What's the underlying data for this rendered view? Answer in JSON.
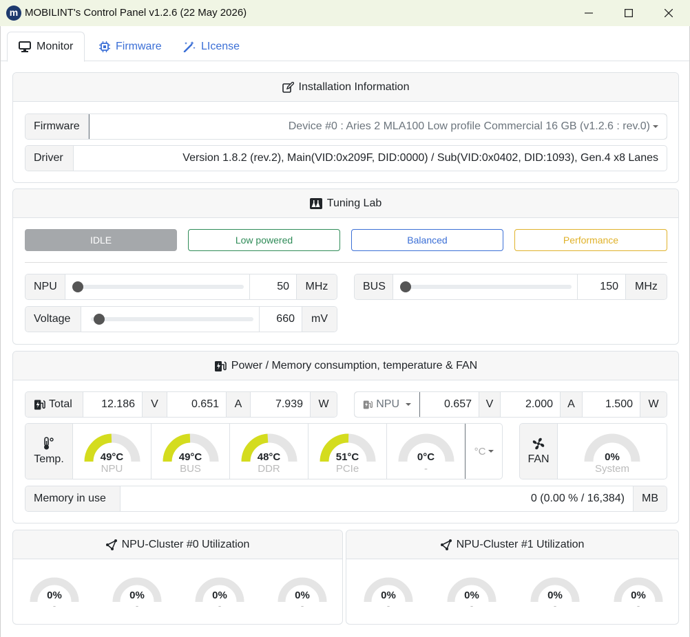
{
  "window": {
    "title": "MOBILINT's Control Panel v1.2.6 (22 May 2026)",
    "logo": "m"
  },
  "tabs": [
    {
      "label": "Monitor",
      "icon": "monitor-icon"
    },
    {
      "label": "Firmware",
      "icon": "chip-icon"
    },
    {
      "label": "LIcense",
      "icon": "wand-icon"
    }
  ],
  "install": {
    "title": "Installation Information",
    "firmware_label": "Firmware",
    "firmware_value": "Device #0 : Aries 2 MLA100 Low profile Commercial 16 GB (v1.2.6 : rev.0)",
    "driver_label": "Driver",
    "driver_value": "Version 1.8.2 (rev.2), Main(VID:0x209F, DID:0000) / Sub(VID:0x0402, DID:1093), Gen.4 x8 Lanes"
  },
  "tuning": {
    "title": "Tuning Lab",
    "modes": [
      {
        "label": "IDLE",
        "color": "#a5a8ab"
      },
      {
        "label": "Low powered",
        "color": "#2e8b57"
      },
      {
        "label": "Balanced",
        "color": "#3b6fd6"
      },
      {
        "label": "Performance",
        "color": "#e0b22a"
      }
    ],
    "npu": {
      "label": "NPU",
      "value": "50",
      "unit": "MHz",
      "level": 0.0
    },
    "bus": {
      "label": "BUS",
      "value": "150",
      "unit": "MHz",
      "level": 0.0
    },
    "voltage": {
      "label": "Voltage",
      "value": "660",
      "unit": "mV",
      "level": 0.05
    }
  },
  "power": {
    "title": "Power / Memory consumption, temperature & FAN",
    "total": {
      "label": "Total",
      "v": "12.186",
      "v_unit": "V",
      "a": "0.651",
      "a_unit": "A",
      "w": "7.939",
      "w_unit": "W"
    },
    "npu": {
      "label": "NPU",
      "v": "0.657",
      "v_unit": "V",
      "a": "2.000",
      "a_unit": "A",
      "w": "1.500",
      "w_unit": "W"
    },
    "temp_label": "Temp.",
    "temps": [
      {
        "value": "49°C",
        "label": "NPU",
        "level": 0.49,
        "color": "#d4dc1e"
      },
      {
        "value": "49°C",
        "label": "BUS",
        "level": 0.49,
        "color": "#d4dc1e"
      },
      {
        "value": "48°C",
        "label": "DDR",
        "level": 0.48,
        "color": "#d4dc1e"
      },
      {
        "value": "51°C",
        "label": "PCIe",
        "level": 0.51,
        "color": "#d4dc1e"
      },
      {
        "value": "0°C",
        "label": "-",
        "level": 0,
        "color": "#d4dc1e"
      }
    ],
    "temp_unit": "°C",
    "fan_label": "FAN",
    "fan": {
      "value": "0%",
      "label": "System",
      "level": 0
    },
    "memory_label": "Memory in use",
    "memory_value": "0 (0.00 % / 16,384)",
    "memory_unit": "MB"
  },
  "clusters": [
    {
      "title": "NPU-Cluster #0 Utilization",
      "cores": [
        {
          "value": "0%",
          "label": "-"
        },
        {
          "value": "0%",
          "label": "-"
        },
        {
          "value": "0%",
          "label": "-"
        },
        {
          "value": "0%",
          "label": "-"
        }
      ]
    },
    {
      "title": "NPU-Cluster #1 Utilization",
      "cores": [
        {
          "value": "0%",
          "label": "-"
        },
        {
          "value": "0%",
          "label": "-"
        },
        {
          "value": "0%",
          "label": "-"
        },
        {
          "value": "0%",
          "label": "-"
        }
      ]
    }
  ]
}
